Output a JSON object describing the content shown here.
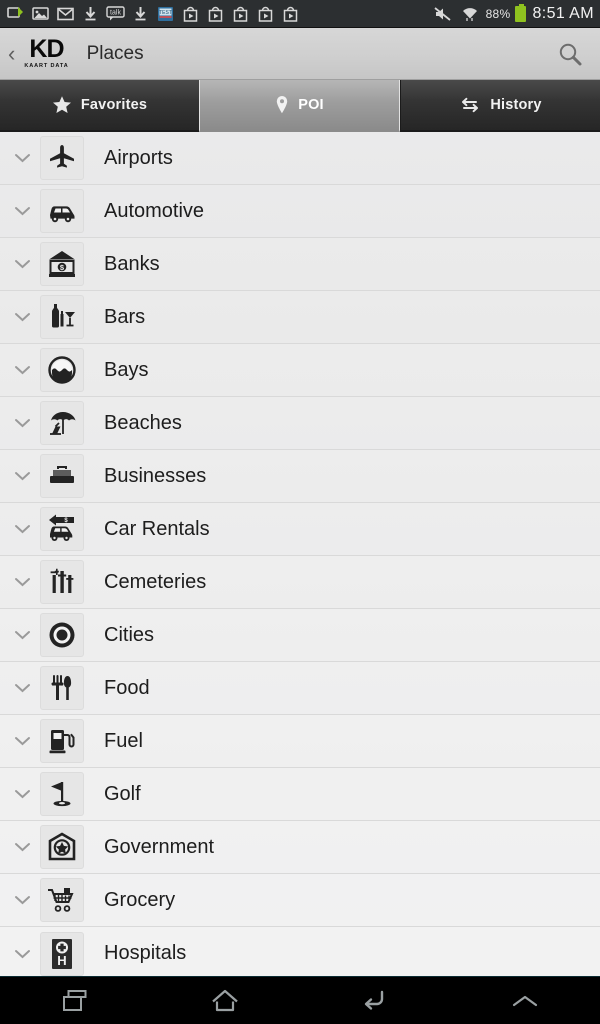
{
  "statusbar": {
    "left_icons": [
      {
        "name": "usb-sync-icon",
        "label": "usb-sync"
      },
      {
        "name": "gallery-icon",
        "label": "gallery"
      },
      {
        "name": "gmail-icon",
        "label": "gmail"
      },
      {
        "name": "download-icon",
        "label": "download"
      },
      {
        "name": "talk-icon",
        "label": "talk"
      },
      {
        "name": "download-icon-2",
        "label": "download"
      },
      {
        "name": "app-icon",
        "label": "app"
      },
      {
        "name": "play-store-icon-1",
        "label": "play-store"
      },
      {
        "name": "play-store-icon-2",
        "label": "play-store"
      },
      {
        "name": "play-store-icon-3",
        "label": "play-store"
      },
      {
        "name": "play-store-icon-4",
        "label": "play-store"
      },
      {
        "name": "play-store-icon-5",
        "label": "play-store"
      }
    ],
    "mute_icon": "mute-icon",
    "wifi_icon": "wifi-icon",
    "battery_percent": "88%",
    "clock": "8:51 AM"
  },
  "actionbar": {
    "back_label": "‹",
    "logo_main": "KD",
    "logo_sub": "KAART DATA",
    "title": "Places",
    "search_icon": "search-icon"
  },
  "tabs": [
    {
      "label": "Favorites",
      "icon": "star-icon",
      "selected": false
    },
    {
      "label": "POI",
      "icon": "map-pin-icon",
      "selected": true
    },
    {
      "label": "History",
      "icon": "swap-arrows-icon",
      "selected": false
    }
  ],
  "list": {
    "items": [
      {
        "label": "Airports",
        "icon": "airplane-icon"
      },
      {
        "label": "Automotive",
        "icon": "car-icon"
      },
      {
        "label": "Banks",
        "icon": "bank-icon"
      },
      {
        "label": "Bars",
        "icon": "bar-drinks-icon"
      },
      {
        "label": "Bays",
        "icon": "bay-icon"
      },
      {
        "label": "Beaches",
        "icon": "beach-umbrella-icon"
      },
      {
        "label": "Businesses",
        "icon": "briefcase-icon"
      },
      {
        "label": "Car Rentals",
        "icon": "car-rental-icon"
      },
      {
        "label": "Cemeteries",
        "icon": "cemetery-crosses-icon"
      },
      {
        "label": "Cities",
        "icon": "city-circle-icon"
      },
      {
        "label": "Food",
        "icon": "fork-knife-icon"
      },
      {
        "label": "Fuel",
        "icon": "fuel-pump-icon"
      },
      {
        "label": "Golf",
        "icon": "golf-flag-icon"
      },
      {
        "label": "Government",
        "icon": "government-building-icon"
      },
      {
        "label": "Grocery",
        "icon": "shopping-cart-icon"
      },
      {
        "label": "Hospitals",
        "icon": "hospital-h-icon"
      }
    ]
  },
  "navbar": {
    "buttons": [
      {
        "name": "recents-button",
        "icon": "recents-icon"
      },
      {
        "name": "home-button",
        "icon": "home-icon"
      },
      {
        "name": "back-button",
        "icon": "back-arrow-icon"
      },
      {
        "name": "expand-button",
        "icon": "chevron-up-icon"
      }
    ]
  },
  "colors": {
    "accent_green": "#8fc21f",
    "statusbar_bg": "#2c2f31",
    "actionbar_bg": "#cfcfcf",
    "tab_selected": "#9d9d9d",
    "list_bg": "#ececed"
  }
}
